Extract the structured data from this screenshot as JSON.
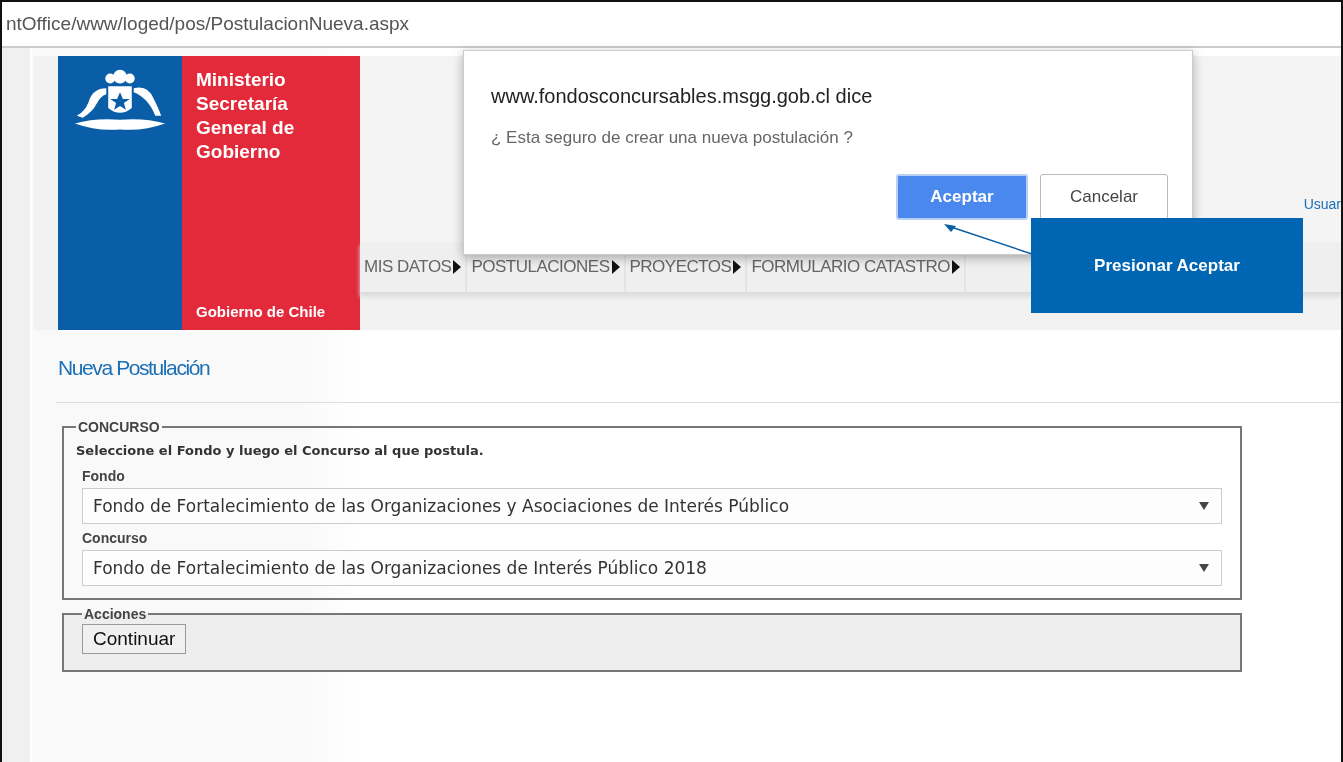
{
  "address_bar": {
    "url": "ntOffice/www/loged/pos/PostulacionNueva.aspx"
  },
  "logo": {
    "lines": [
      "Ministerio",
      "Secretaría",
      "General de",
      "Gobierno"
    ],
    "footer": "Gobierno de Chile"
  },
  "header": {
    "user_link": "Usuar"
  },
  "nav": [
    {
      "label": "MIS DATOS"
    },
    {
      "label": "POSTULACIONES"
    },
    {
      "label": "PROYECTOS"
    },
    {
      "label": "FORMULARIO CATASTRO"
    }
  ],
  "page_title": "Nueva Postulación",
  "concurso": {
    "legend": "CONCURSO",
    "instruction": "Seleccione el Fondo y luego el Concurso al que postula.",
    "fields": [
      {
        "label": "Fondo",
        "value": "Fondo de Fortalecimiento de las Organizaciones y Asociaciones de Interés Público"
      },
      {
        "label": "Concurso",
        "value": "Fondo de Fortalecimiento de las Organizaciones de Interés Público 2018"
      }
    ]
  },
  "acciones": {
    "legend": "Acciones",
    "button": "Continuar"
  },
  "dialog": {
    "title": "www.fondosconcursables.msgg.gob.cl dice",
    "message": "¿ Esta seguro de crear una nueva postulación ?",
    "buttons": [
      {
        "label": "Aceptar",
        "selected": true
      },
      {
        "label": "Cancelar",
        "selected": false
      }
    ]
  },
  "callout": {
    "text": "Presionar Aceptar"
  }
}
